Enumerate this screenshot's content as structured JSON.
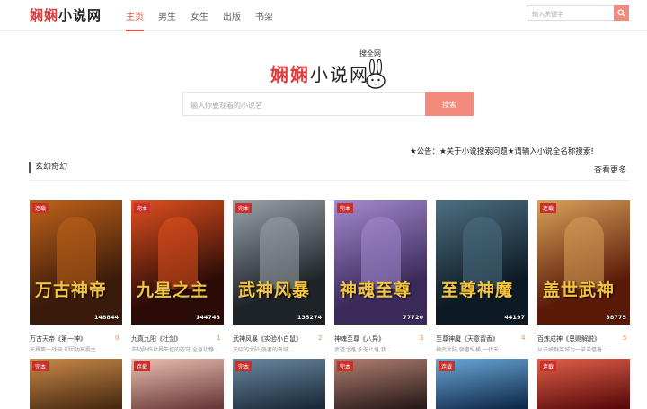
{
  "header": {
    "logo_red": "娴娴",
    "logo_dark": "小说网",
    "nav": [
      "主页",
      "男生",
      "女生",
      "出版",
      "书架"
    ],
    "search_placeholder": "输入关键字"
  },
  "hero": {
    "logo_red": "娴娴",
    "logo_dark": "小说网",
    "sub": "搜全网",
    "search_placeholder": "输入你要观看的小说名",
    "search_button": "搜索"
  },
  "notice": "★公告：★关于小说搜索问题★请输入小说全名称搜索!",
  "section": {
    "title": "玄幻奇幻",
    "more": "查看更多"
  },
  "books": [
    {
      "badge": "连载",
      "count": "148844",
      "cover_text": "万古神帝",
      "name": "万古天帝《第一神》",
      "num": "0",
      "desc": "天界第一战神,却因功高震主...",
      "colors": [
        "#3a1a0a",
        "#c0621a"
      ]
    },
    {
      "badge": "完本",
      "count": "144743",
      "cover_text": "九星之主",
      "name": "九真九阳《杜剑》",
      "num": "1",
      "desc": "浩劫降临世界失控的苍穹,全身功静...",
      "colors": [
        "#2a0b06",
        "#e0501e"
      ]
    },
    {
      "badge": "完本",
      "count": "135274",
      "cover_text": "武神风暴",
      "name": "武神风暴《实验小白鼠》",
      "num": "2",
      "desc": "天际的大陆,强者的海域...",
      "colors": [
        "#1e2328",
        "#9aa3a8"
      ]
    },
    {
      "badge": "完本",
      "count": "77720",
      "cover_text": "神魂至尊",
      "name": "神魂至尊《八异》",
      "num": "3",
      "desc": "武道之路,永无止境,我...",
      "colors": [
        "#3a2a5a",
        "#a48ad0"
      ]
    },
    {
      "badge": "",
      "count": "44197",
      "cover_text": "至尊神魔",
      "name": "至尊神魔《天意留香》",
      "num": "4",
      "desc": "神武大陆,强者纵横,一代天...",
      "colors": [
        "#0d1a24",
        "#4d6f82"
      ]
    },
    {
      "badge": "连载",
      "count": "38775",
      "cover_text": "盖世武神",
      "name": "百炼成神《恩赐解脱》",
      "num": "5",
      "desc": "从云峡群英城为一弟弟借着...",
      "colors": [
        "#5a1a08",
        "#d8a25a"
      ]
    }
  ],
  "books_row2": [
    {
      "badge": "完本",
      "colors": [
        "#4a2a10",
        "#c88a4a"
      ]
    },
    {
      "badge": "连载",
      "colors": [
        "#6a3a3a",
        "#e8c0b0"
      ]
    },
    {
      "badge": "完本",
      "colors": [
        "#1a2a3a",
        "#6a88a0"
      ]
    },
    {
      "badge": "完本",
      "colors": [
        "#2a1a1a",
        "#b08070"
      ]
    },
    {
      "badge": "连载",
      "colors": [
        "#102a4a",
        "#6aa8d8"
      ]
    },
    {
      "badge": "连载",
      "colors": [
        "#5a0a0a",
        "#e0604a"
      ]
    }
  ]
}
